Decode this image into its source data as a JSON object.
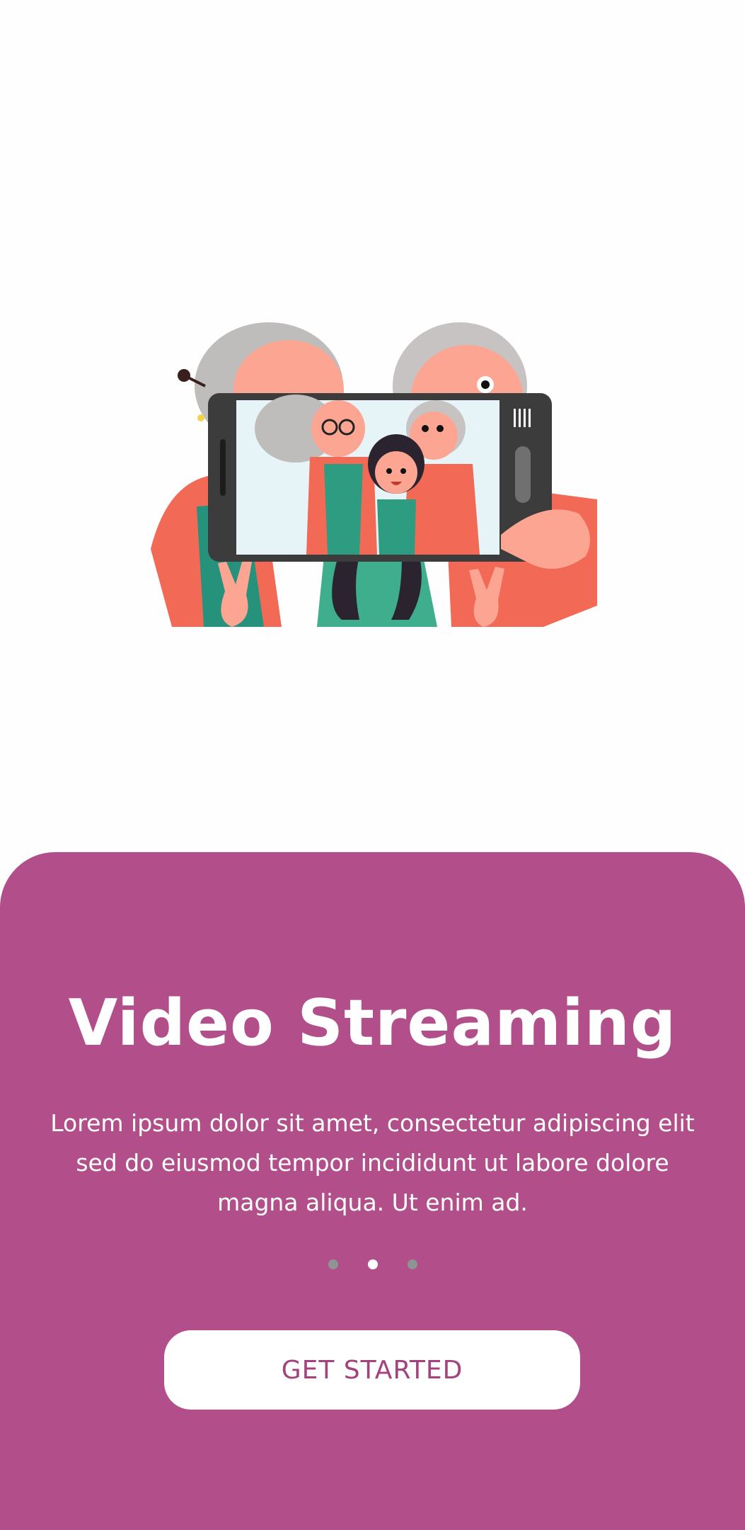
{
  "onboarding": {
    "title": "Video Streaming",
    "description": "Lorem ipsum dolor sit amet, consectetur adipiscing elit sed do eiusmod tempor incididunt ut labore dolore magna aliqua. Ut enim ad.",
    "cta_label": "GET STARTED",
    "pager": {
      "total": 3,
      "active_index": 1
    }
  },
  "colors": {
    "panel_bg": "#b24f8a",
    "cta_text": "#a4427d",
    "dot_inactive": "#8d9593",
    "dot_active": "#ffffff"
  },
  "illustration": {
    "icon": "family-selfie-illustration"
  }
}
